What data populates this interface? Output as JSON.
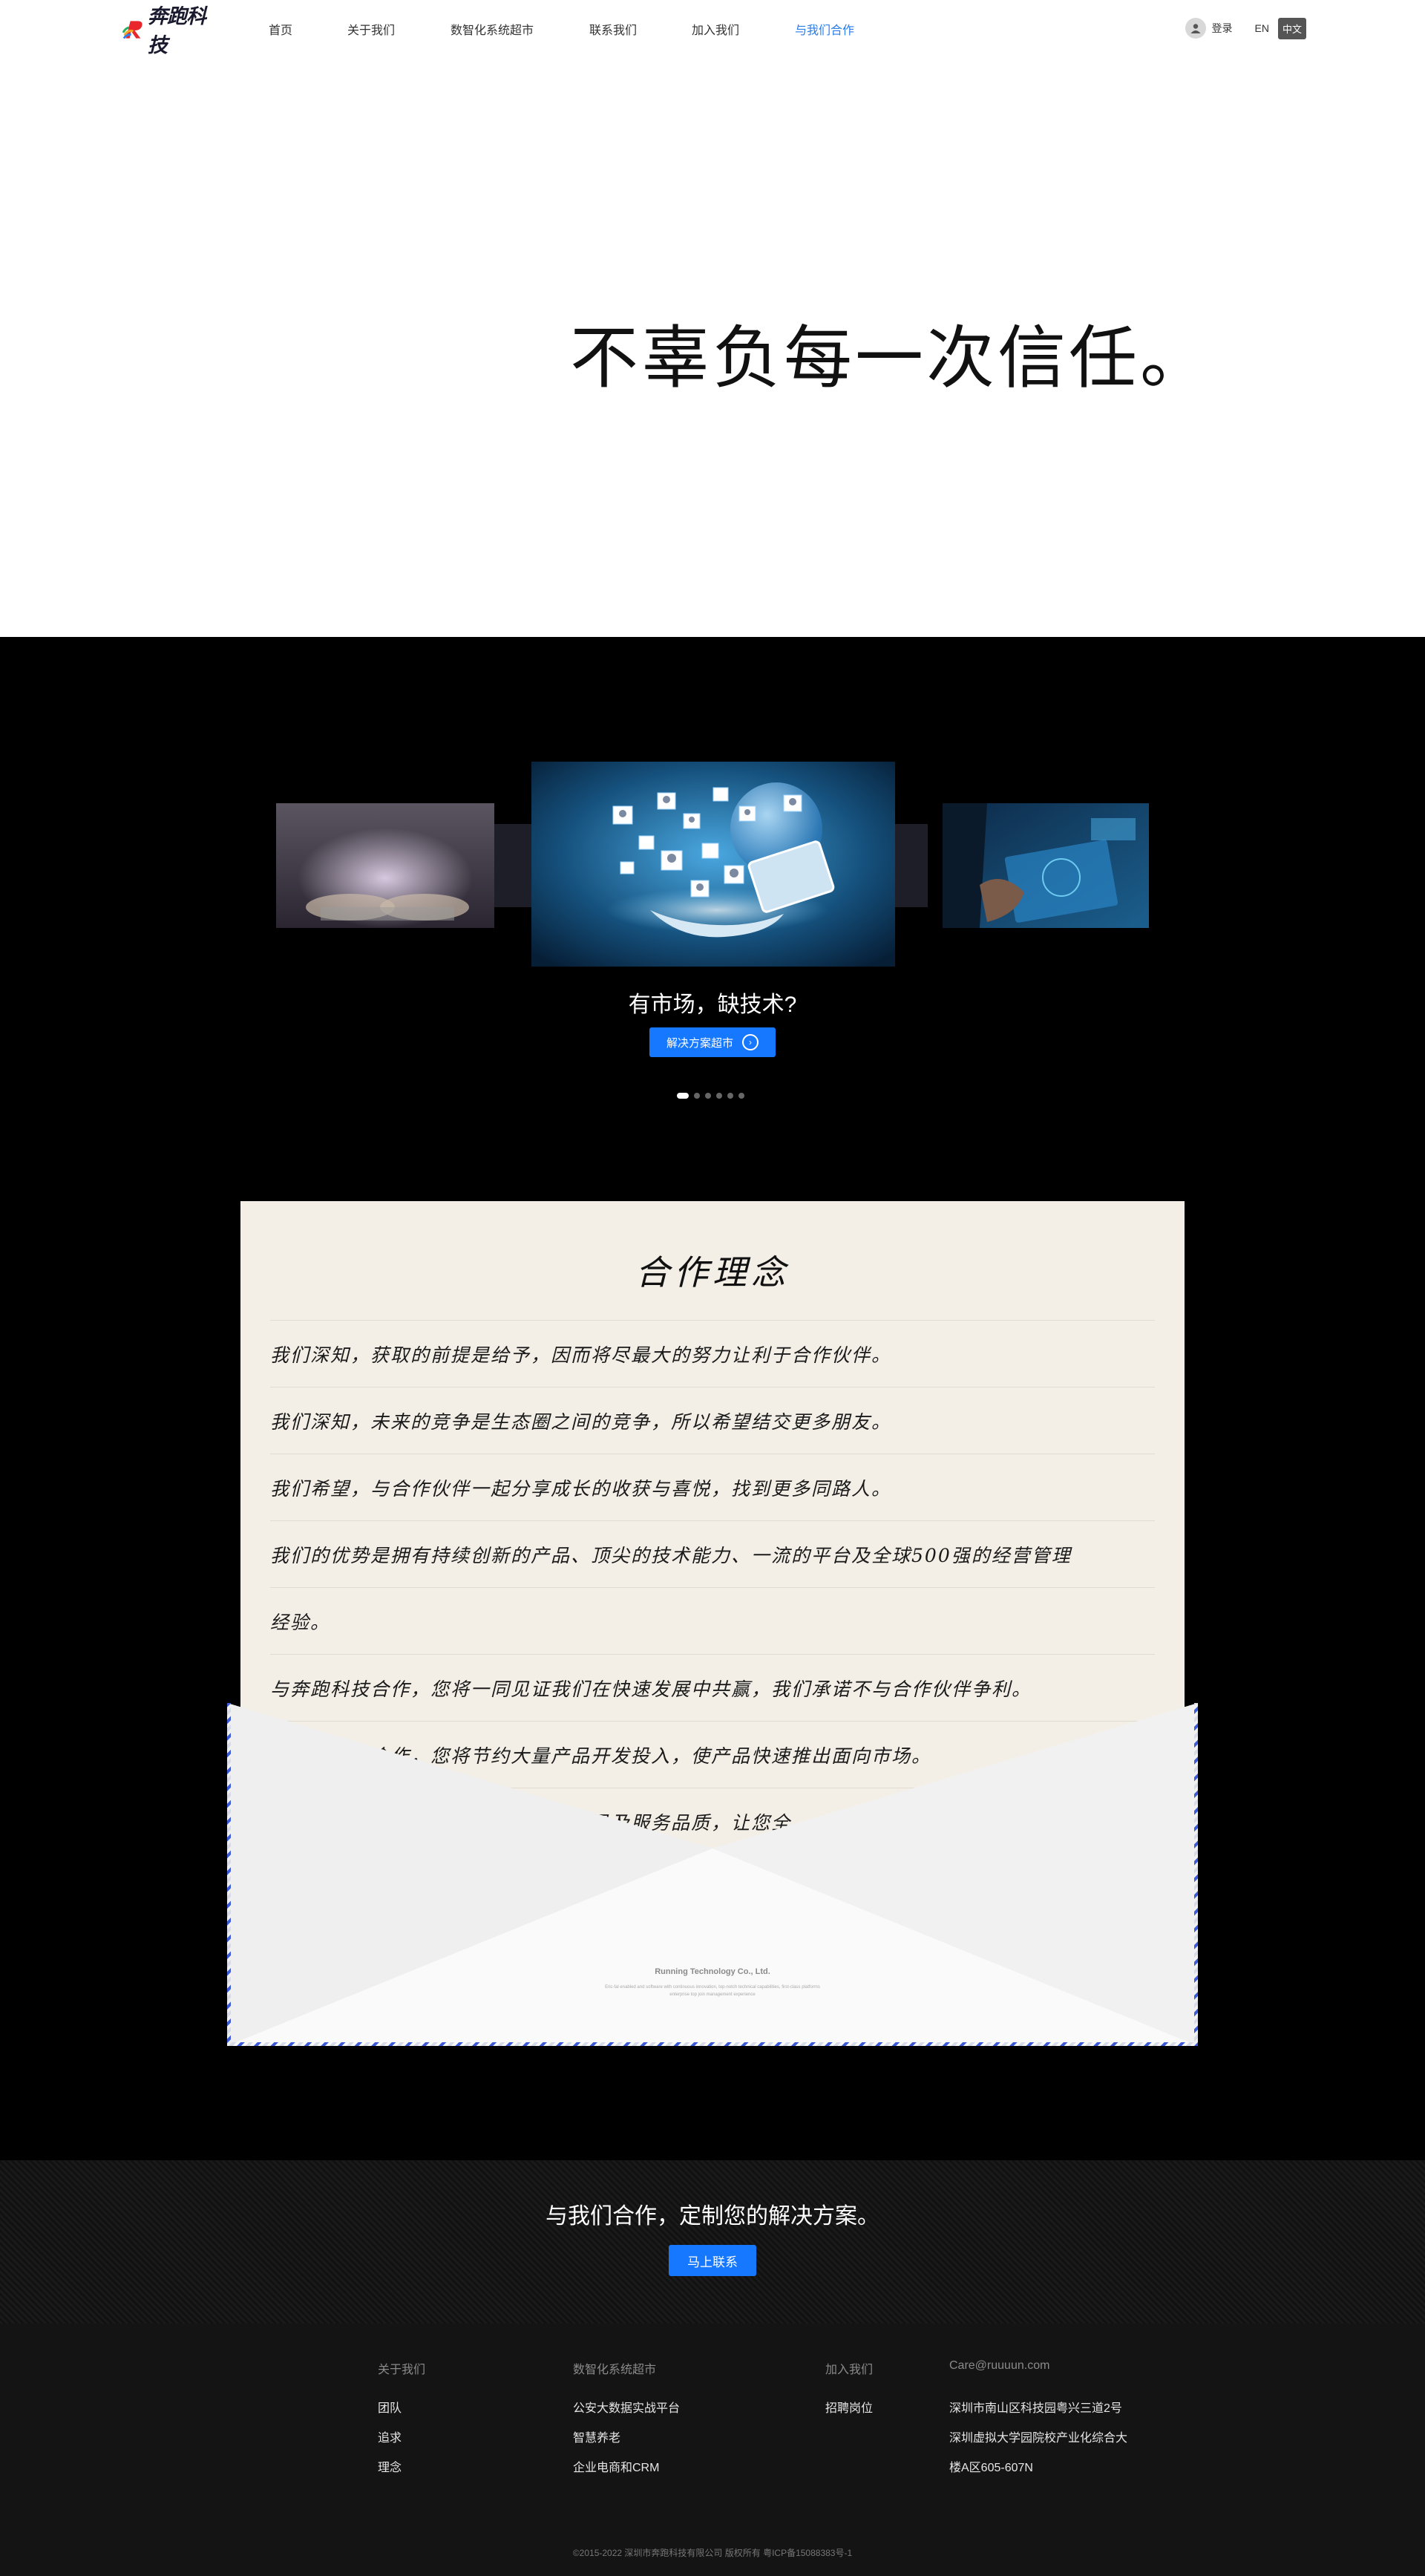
{
  "header": {
    "logo_text": "奔跑科技",
    "nav": [
      {
        "label": "首页",
        "active": false
      },
      {
        "label": "关于我们",
        "active": false
      },
      {
        "label": "数智化系统超市",
        "active": false
      },
      {
        "label": "联系我们",
        "active": false
      },
      {
        "label": "加入我们",
        "active": false
      },
      {
        "label": "与我们合作",
        "active": true
      }
    ],
    "login": "登录",
    "lang_en": "EN",
    "lang_zh": "中文",
    "accent_color": "#2b7de9"
  },
  "hero": {
    "slogan": "不辜负每一次信任。"
  },
  "carousel": {
    "caption": "有市场，缺技术?",
    "button_label": "解决方案超市",
    "slide_count": 6,
    "active_index": 0
  },
  "letter": {
    "title": "合作理念",
    "lines": [
      "我们深知，获取的前提是给予，因而将尽最大的努力让利于合作伙伴。",
      "我们深知，未来的竞争是生态圈之间的竞争，所以希望结交更多朋友。",
      "我们希望，与合作伙伴一起分享成长的收获与喜悦，找到更多同路人。",
      "我们的优势是拥有持续创新的产品、顶尖的技术能力、一流的平台及全球500强的经营管理",
      "经验。",
      "与奔跑科技合作，您将一同见证我们在快速发展中共赢，我们承诺不与合作伙伴争利。",
      "与奔跑科技合作，您将节约大量产品开发投入，使产品快速推出面向市场。",
      "与奔跑科技合作，您将享有一流的产品及服务品质，让您全"
    ],
    "envelope_company": "Running Technology Co., Ltd.",
    "envelope_tagline_1": "Eric-fal enabled and software with continuous innovation, top-notch technical capabilities, first-class platforms",
    "envelope_tagline_2": "enterprise top join management experience"
  },
  "footer": {
    "cta_text": "与我们合作，定制您的解决方案。",
    "cta_button": "马上联系",
    "columns": [
      {
        "heading": "关于我们",
        "links": [
          "团队",
          "追求",
          "理念"
        ]
      },
      {
        "heading": "数智化系统超市",
        "links": [
          "公安大数据实战平台",
          "智慧养老",
          "企业电商和CRM"
        ]
      },
      {
        "heading": "加入我们",
        "links": [
          "招聘岗位"
        ]
      },
      {
        "heading": "Care@ruuuun.com",
        "links": [
          "深圳市南山区科技园粤兴三道2号",
          "深圳虚拟大学园院校产业化综合大",
          "楼A区605-607N"
        ]
      }
    ],
    "copyright": "©2015-2022 深圳市奔跑科技有限公司 版权所有 粤ICP备15088383号-1",
    "cta_color": "#1677ff"
  }
}
